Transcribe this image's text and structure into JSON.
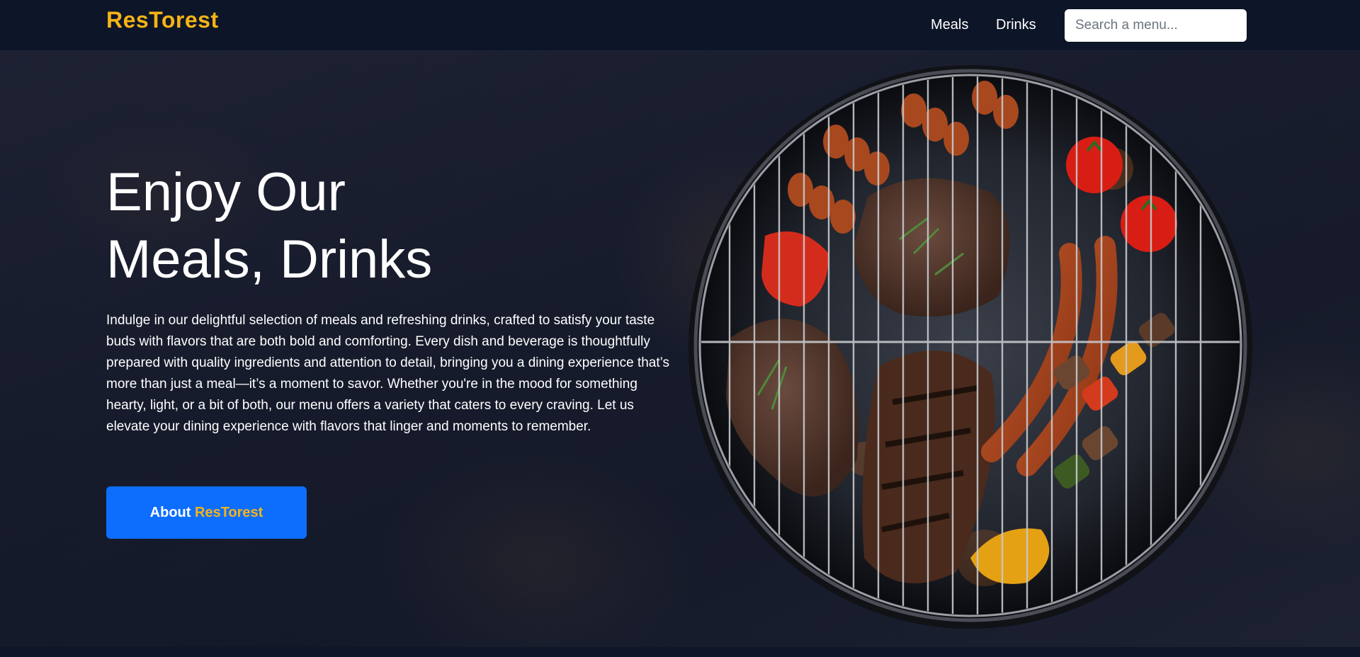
{
  "navbar": {
    "brand": "ResTorest",
    "links": [
      "Meals",
      "Drinks"
    ],
    "search_placeholder": "Search a menu..."
  },
  "hero": {
    "title_line1": "Enjoy Our",
    "title_line2": "Meals, Drinks",
    "description": "Indulge in our delightful selection of meals and refreshing drinks, crafted to satisfy your taste buds with flavors that are both bold and comforting. Every dish and beverage is thoughtfully prepared with quality ingredients and attention to detail, bringing you a dining experience that’s more than just a meal—it’s a moment to savor. Whether you're in the mood for something hearty, light, or a bit of both, our menu offers a variety that caters to every craving. Let us elevate your dining experience with flavors that linger and moments to remember.",
    "button_prefix": "About",
    "button_brand": "ResTorest"
  },
  "colors": {
    "brand": "#f5b317",
    "navbar_bg": "#0d1528",
    "button": "#0d6efd"
  },
  "image": {
    "icon": "bbq-grill-photo"
  }
}
